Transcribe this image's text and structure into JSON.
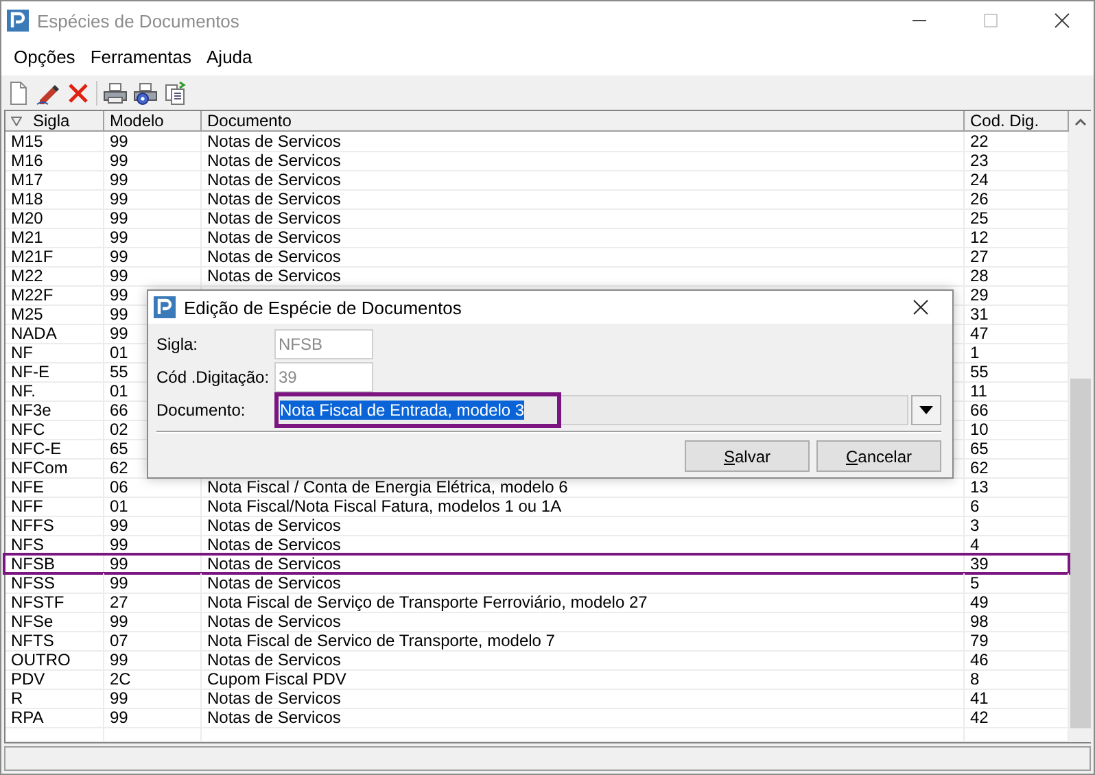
{
  "window": {
    "title": "Espécies de Documentos"
  },
  "menu": [
    "Opções",
    "Ferramentas",
    "Ajuda"
  ],
  "table": {
    "columns": [
      "Sigla",
      "Modelo",
      "Documento",
      "Cod. Dig."
    ],
    "rows": [
      {
        "sigla": "M15",
        "modelo": "99",
        "documento": "Notas de Servicos",
        "cod": "22",
        "highlighted": false
      },
      {
        "sigla": "M16",
        "modelo": "99",
        "documento": "Notas de Servicos",
        "cod": "23",
        "highlighted": false
      },
      {
        "sigla": "M17",
        "modelo": "99",
        "documento": "Notas de Servicos",
        "cod": "24",
        "highlighted": false
      },
      {
        "sigla": "M18",
        "modelo": "99",
        "documento": "Notas de Servicos",
        "cod": "26",
        "highlighted": false
      },
      {
        "sigla": "M20",
        "modelo": "99",
        "documento": "Notas de Servicos",
        "cod": "25",
        "highlighted": false
      },
      {
        "sigla": "M21",
        "modelo": "99",
        "documento": "Notas de Servicos",
        "cod": "12",
        "highlighted": false
      },
      {
        "sigla": "M21F",
        "modelo": "99",
        "documento": "Notas de Servicos",
        "cod": "27",
        "highlighted": false
      },
      {
        "sigla": "M22",
        "modelo": "99",
        "documento": "Notas de Servicos",
        "cod": "28",
        "highlighted": false
      },
      {
        "sigla": "M22F",
        "modelo": "99",
        "cod": "29",
        "highlighted": false
      },
      {
        "sigla": "M25",
        "modelo": "99",
        "cod": "31",
        "highlighted": false
      },
      {
        "sigla": "NADA",
        "modelo": "99",
        "cod": "47",
        "highlighted": false
      },
      {
        "sigla": "NF",
        "modelo": "01",
        "cod": "1",
        "highlighted": false
      },
      {
        "sigla": "NF-E",
        "modelo": "55",
        "cod": "55",
        "highlighted": false
      },
      {
        "sigla": "NF.",
        "modelo": "01",
        "cod": "11",
        "highlighted": false
      },
      {
        "sigla": "NF3e",
        "modelo": "66",
        "cod": "66",
        "highlighted": false
      },
      {
        "sigla": "NFC",
        "modelo": "02",
        "cod": "10",
        "highlighted": false
      },
      {
        "sigla": "NFC-E",
        "modelo": "65",
        "cod": "65",
        "highlighted": false
      },
      {
        "sigla": "NFCom",
        "modelo": "62",
        "cod": "62",
        "highlighted": false
      },
      {
        "sigla": "NFE",
        "modelo": "06",
        "documento": "Nota Fiscal / Conta de Energia Elétrica, modelo 6",
        "cod": "13",
        "highlighted": false
      },
      {
        "sigla": "NFF",
        "modelo": "01",
        "documento": "Nota Fiscal/Nota Fiscal Fatura, modelos 1 ou 1A",
        "cod": "6",
        "highlighted": false
      },
      {
        "sigla": "NFFS",
        "modelo": "99",
        "documento": "Notas de Servicos",
        "cod": "3",
        "highlighted": false
      },
      {
        "sigla": "NFS",
        "modelo": "99",
        "documento": "Notas de Servicos",
        "cod": "4",
        "highlighted": false
      },
      {
        "sigla": "NFSB",
        "modelo": "99",
        "documento": "Notas de Servicos",
        "cod": "39",
        "highlighted": true
      },
      {
        "sigla": "NFSS",
        "modelo": "99",
        "documento": "Notas de Servicos",
        "cod": "5",
        "highlighted": false
      },
      {
        "sigla": "NFSTF",
        "modelo": "27",
        "documento": "Nota Fiscal de Serviço de Transporte Ferroviário, modelo 27",
        "cod": "49",
        "highlighted": false
      },
      {
        "sigla": "NFSe",
        "modelo": "99",
        "documento": "Notas de Servicos",
        "cod": "98",
        "highlighted": false
      },
      {
        "sigla": "NFTS",
        "modelo": "07",
        "documento": "Nota Fiscal de Servico de Transporte, modelo 7",
        "cod": "79",
        "highlighted": false
      },
      {
        "sigla": "OUTRO",
        "modelo": "99",
        "documento": "Notas de Servicos",
        "cod": "46",
        "highlighted": false
      },
      {
        "sigla": "PDV",
        "modelo": "2C",
        "documento": "Cupom Fiscal PDV",
        "cod": "8",
        "highlighted": false
      },
      {
        "sigla": "R",
        "modelo": "99",
        "documento": "Notas de Servicos",
        "cod": "41",
        "highlighted": false
      },
      {
        "sigla": "RPA",
        "modelo": "99",
        "documento": "Notas de Servicos",
        "cod": "42",
        "highlighted": false
      }
    ]
  },
  "dialog": {
    "title": "Edição de Espécie de Documentos",
    "sigla": {
      "label": "Sigla:",
      "value": "NFSB",
      "disabled": true
    },
    "codigo": {
      "label": "Cód .Digitação:",
      "value": "39",
      "disabled": true
    },
    "documento": {
      "label": "Documento:",
      "value": "Nota Fiscal de Entrada, modelo 3",
      "highlighted": true
    },
    "buttons": [
      "Salvar",
      "Cancelar"
    ]
  }
}
